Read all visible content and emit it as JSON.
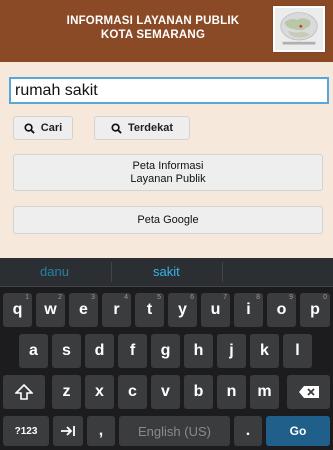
{
  "header": {
    "title_line1": "INFORMASI LAYANAN PUBLIK",
    "title_line2": "KOTA SEMARANG",
    "logo_icon": "globe-map-icon"
  },
  "search": {
    "value": "rumah sakit"
  },
  "buttons": {
    "cari": "Cari",
    "terdekat": "Terdekat",
    "peta_info_line1": "Peta Informasi",
    "peta_info_line2": "Layanan Publik",
    "peta_google": "Peta Google"
  },
  "keyboard": {
    "suggestions": [
      "danu",
      "sakit"
    ],
    "row1": [
      "q",
      "w",
      "e",
      "r",
      "t",
      "y",
      "u",
      "i",
      "o",
      "p"
    ],
    "row1_hints": [
      "1",
      "2",
      "3",
      "4",
      "5",
      "6",
      "7",
      "8",
      "9",
      "0"
    ],
    "row2": [
      "a",
      "s",
      "d",
      "f",
      "g",
      "h",
      "j",
      "k",
      "l"
    ],
    "row3": [
      "z",
      "x",
      "c",
      "v",
      "b",
      "n",
      "m"
    ],
    "symbols_label": "?123",
    "comma_label": ",",
    "space_label": "English (US)",
    "period_label": ".",
    "go_label": "Go"
  },
  "colors": {
    "header": "#8a4a26",
    "background": "#f7e8dc",
    "accent": "#33b5e5"
  }
}
